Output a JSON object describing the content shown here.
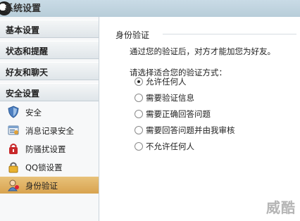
{
  "window": {
    "title": "系统设置"
  },
  "sidebar": {
    "categories": [
      {
        "label": "基本设置"
      },
      {
        "label": "状态和提醒"
      },
      {
        "label": "好友和聊天"
      },
      {
        "label": "安全设置"
      }
    ],
    "items": [
      {
        "label": "安全",
        "icon": "shield-icon"
      },
      {
        "label": "消息记录安全",
        "icon": "message-log-icon"
      },
      {
        "label": "防骚扰设置",
        "icon": "anti-harass-icon"
      },
      {
        "label": "QQ锁设置",
        "icon": "lock-icon"
      },
      {
        "label": "身份验证",
        "icon": "user-verify-icon",
        "selected": true
      }
    ]
  },
  "main": {
    "section_title": "身份验证",
    "description": "通过您的验证后，对方才能加您为好友。",
    "prompt": "请选择适合您的验证方式：",
    "options": [
      {
        "label": "允许任何人",
        "selected": true
      },
      {
        "label": "需要验证信息",
        "selected": false
      },
      {
        "label": "需要正确回答问题",
        "selected": false
      },
      {
        "label": "需要回答问题并由我审核",
        "selected": false
      },
      {
        "label": "不允许任何人",
        "selected": false
      }
    ]
  },
  "watermark": "威酷",
  "colors": {
    "selected_bg": "#d8a34f",
    "titlebar": "#b8cdd9"
  }
}
